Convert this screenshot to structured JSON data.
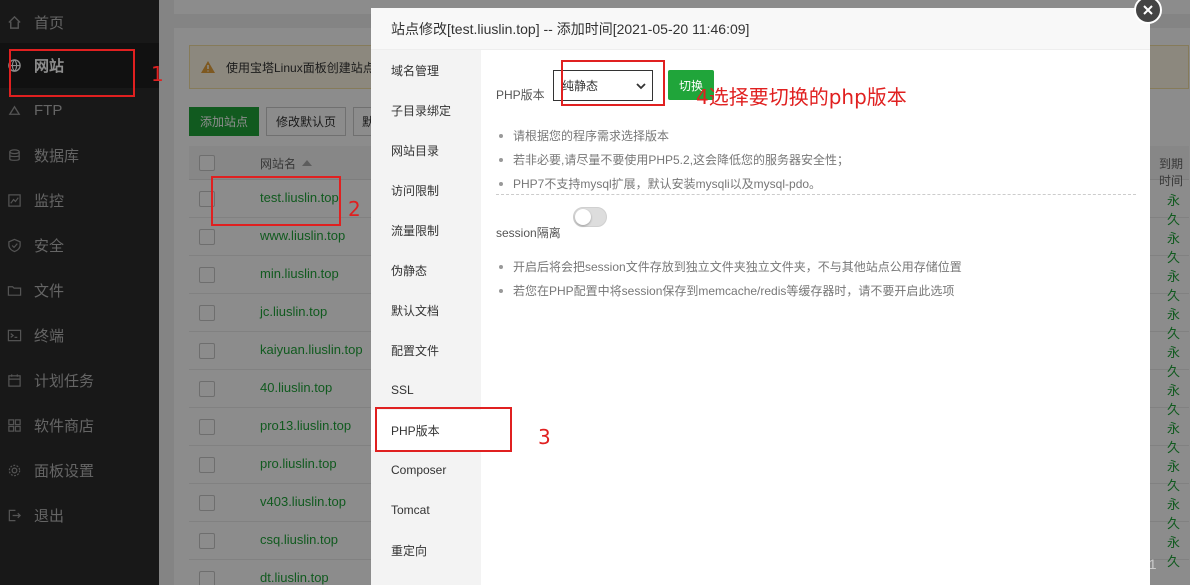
{
  "sidebar": {
    "items": [
      {
        "label": "首页",
        "icon": "home-icon"
      },
      {
        "label": "网站",
        "icon": "globe-icon",
        "active": true
      },
      {
        "label": "FTP",
        "icon": "ftp-icon"
      },
      {
        "label": "数据库",
        "icon": "database-icon"
      },
      {
        "label": "监控",
        "icon": "monitor-icon"
      },
      {
        "label": "安全",
        "icon": "shield-icon"
      },
      {
        "label": "文件",
        "icon": "folder-icon"
      },
      {
        "label": "终端",
        "icon": "terminal-icon"
      },
      {
        "label": "计划任务",
        "icon": "calendar-icon"
      },
      {
        "label": "软件商店",
        "icon": "grid-icon"
      },
      {
        "label": "面板设置",
        "icon": "gear-icon"
      },
      {
        "label": "退出",
        "icon": "logout-icon"
      }
    ]
  },
  "main": {
    "warning_text": "使用宝塔Linux面板创建站点",
    "toolbar": {
      "add_site": "添加站点",
      "modify_default": "修改默认页",
      "more": "默"
    },
    "table": {
      "col_name": "网站名",
      "col_expire": "到期时间",
      "rows": [
        {
          "name": "test.liuslin.top",
          "expire": "永久"
        },
        {
          "name": "www.liuslin.top",
          "expire": "永久"
        },
        {
          "name": "min.liuslin.top",
          "expire": "永久"
        },
        {
          "name": "jc.liuslin.top",
          "expire": "永久"
        },
        {
          "name": "kaiyuan.liuslin.top",
          "expire": "永久"
        },
        {
          "name": "40.liuslin.top",
          "expire": "永久"
        },
        {
          "name": "pro13.liuslin.top",
          "expire": "永久"
        },
        {
          "name": "pro.liuslin.top",
          "expire": "永久"
        },
        {
          "name": "v403.liuslin.top",
          "expire": "永久"
        },
        {
          "name": "csq.liuslin.top",
          "expire": "永久"
        },
        {
          "name": "dt.liuslin.top",
          "expire": ""
        }
      ]
    }
  },
  "modal": {
    "title": "站点修改[test.liuslin.top] -- 添加时间[2021-05-20 11:46:09]",
    "tabs": [
      {
        "label": "域名管理"
      },
      {
        "label": "子目录绑定"
      },
      {
        "label": "网站目录"
      },
      {
        "label": "访问限制"
      },
      {
        "label": "流量限制"
      },
      {
        "label": "伪静态"
      },
      {
        "label": "默认文档"
      },
      {
        "label": "配置文件"
      },
      {
        "label": "SSL"
      },
      {
        "label": "PHP版本",
        "active": true
      },
      {
        "label": "Composer"
      },
      {
        "label": "Tomcat"
      },
      {
        "label": "重定向"
      }
    ],
    "php": {
      "label": "PHP版本",
      "selected": "纯静态",
      "switch_label": "切换",
      "tips": [
        "请根据您的程序需求选择版本",
        "若非必要,请尽量不要使用PHP5.2,这会降低您的服务器安全性；",
        "PHP7不支持mysql扩展，默认安装mysqli以及mysql-pdo。"
      ]
    },
    "session": {
      "label": "session隔离",
      "enabled": false,
      "tips": [
        "开启后将会把session文件存放到独立文件夹独立文件夹，不与其他站点公用存储位置",
        "若您在PHP配置中将session保存到memcache/redis等缓存器时，请不要开启此选项"
      ]
    }
  },
  "annotations": {
    "step1": "1",
    "step2": "2",
    "step3": "3",
    "step4": "4选择要切换的php版本",
    "color": "#e02020"
  },
  "watermark": "https://blog.csdn.net/fate_sky8521"
}
